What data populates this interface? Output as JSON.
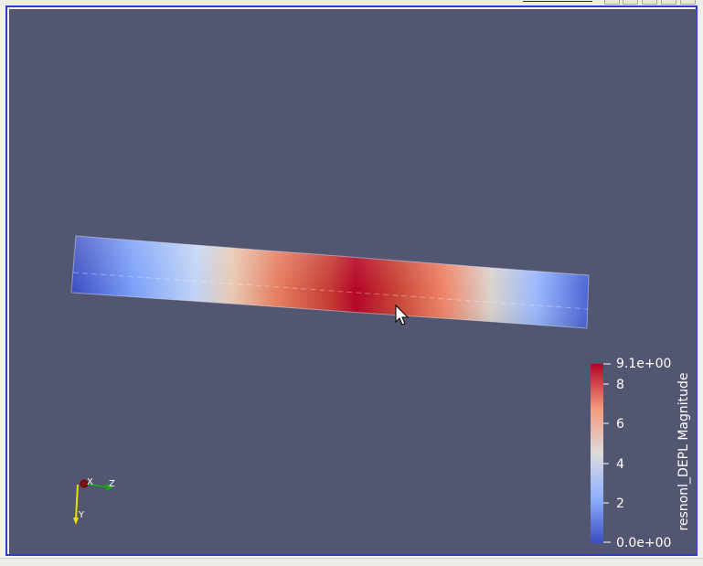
{
  "colors": {
    "viewport_background": "#535670",
    "frame_border": "#2b3cd6",
    "colormap_low": "#3b4cc0",
    "colormap_mid": "#dddcdc",
    "colormap_high": "#b40426"
  },
  "scalar_bar": {
    "title": "resnonl_DEPL Magnitude",
    "max_label": "9.1e+00",
    "min_label": "0.0e+00",
    "tick_labels": [
      "8",
      "6",
      "4",
      "2"
    ],
    "range": [
      0.0,
      9.1
    ],
    "ticks": [
      8,
      6,
      4,
      2
    ]
  },
  "orientation_axes": {
    "x_label": "X",
    "y_label": "Y",
    "z_label": "Z"
  },
  "cursor": {
    "icon": "mouse-pointer-icon"
  }
}
